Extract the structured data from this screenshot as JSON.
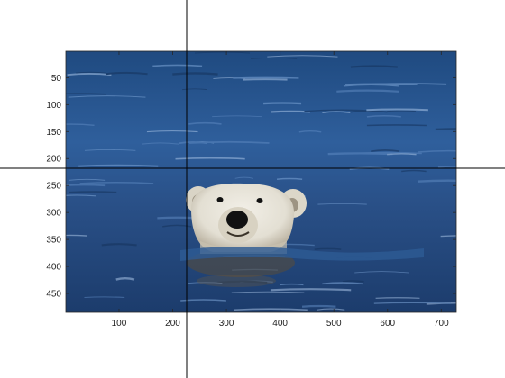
{
  "figure": {
    "background": "#ffffff"
  },
  "image": {
    "subject": "polar bear swimming",
    "colors": {
      "water_dark": "#1d3b66",
      "water_mid": "#3a6aa6",
      "water_light": "#6f9bd0",
      "fur": "#e9e6dc",
      "fur_shadow": "#b9b2a1",
      "nose": "#111111",
      "reflection": "#6b5a40"
    }
  },
  "axes": {
    "xlim": [
      1,
      728
    ],
    "ylim": [
      1,
      485
    ],
    "y_reversed": true,
    "x_ticks": [
      100,
      200,
      300,
      400,
      500,
      600,
      700
    ],
    "y_ticks": [
      50,
      100,
      150,
      200,
      250,
      300,
      350,
      400,
      450
    ],
    "x_tick_labels": [
      "100",
      "200",
      "300",
      "400",
      "500",
      "600",
      "700"
    ],
    "y_tick_labels": [
      "50",
      "100",
      "150",
      "200",
      "250",
      "300",
      "350",
      "400",
      "450"
    ],
    "box_color": "#262626"
  },
  "crosshair": {
    "x": 226,
    "y": 218,
    "color": "#000000"
  }
}
